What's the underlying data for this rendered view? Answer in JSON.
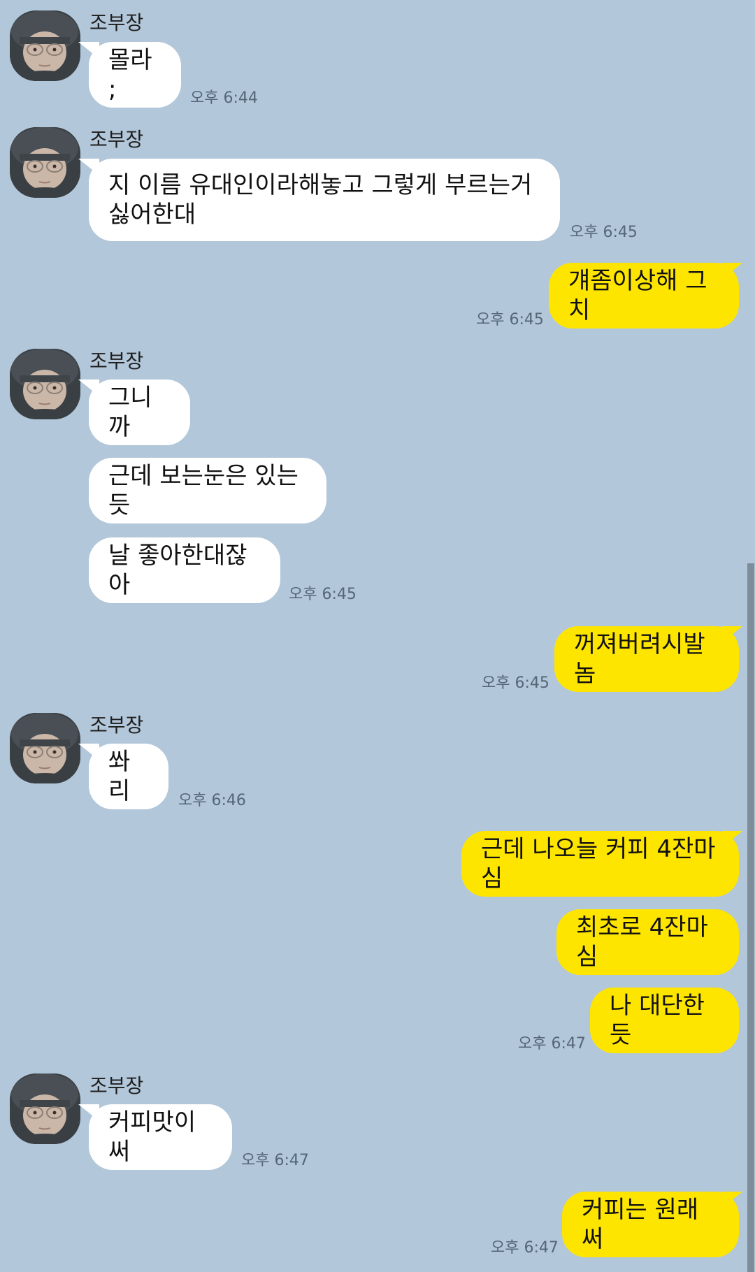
{
  "sender_name": "조부장",
  "messages": [
    {
      "text": "몰라 ;",
      "time": "오후 6:44"
    },
    {
      "text": "지 이름 유대인이라해놓고 그렇게 부르는거\n싫어한대",
      "time": "오후 6:45"
    },
    {
      "text": "걔좀이상해 그치",
      "time": "오후 6:45"
    },
    {
      "text": "그니까"
    },
    {
      "text": "근데 보는눈은 있는듯"
    },
    {
      "text": "날 좋아한대잖아",
      "time": "오후 6:45"
    },
    {
      "text": "꺼져버려시발놈",
      "time": "오후 6:45"
    },
    {
      "text": "쏴리",
      "time": "오후 6:46"
    },
    {
      "text": "근데 나오늘 커피 4잔마심"
    },
    {
      "text": "최초로 4잔마심"
    },
    {
      "text": "나 대단한듯",
      "time": "오후 6:47"
    },
    {
      "text": "커피맛이써",
      "time": "오후 6:47"
    },
    {
      "text": "커피는 원래 써",
      "time": "오후 6:47"
    }
  ],
  "colors": {
    "background": "#b2c7d9",
    "incoming_bubble": "#ffffff",
    "outgoing_bubble": "#fee500"
  },
  "icons": {
    "avatar": "profile-photo"
  }
}
